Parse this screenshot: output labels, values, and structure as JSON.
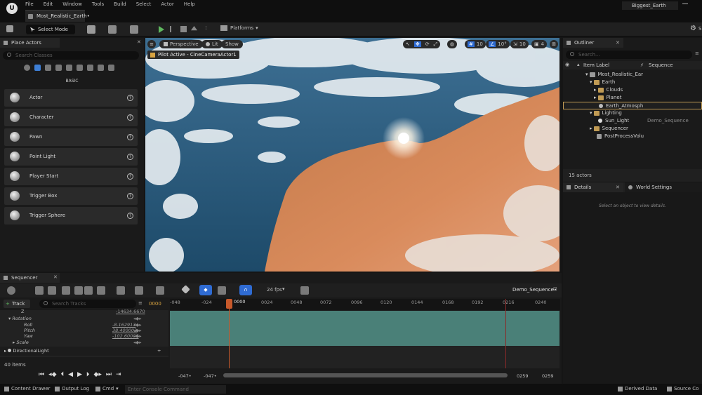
{
  "menu": [
    "File",
    "Edit",
    "Window",
    "Tools",
    "Build",
    "Select",
    "Actor",
    "Help"
  ],
  "level_tab": "Most_Realistic_Earth•",
  "project_name": "Biggest_Earth",
  "toolbar": {
    "select_mode": "Select Mode",
    "platforms": "Platforms",
    "settings_short": "S"
  },
  "place_actors": {
    "title": "Place Actors",
    "search_placeholder": "Search Classes",
    "section": "BASIC",
    "items": [
      "Actor",
      "Character",
      "Pawn",
      "Point Light",
      "Player Start",
      "Trigger Box",
      "Trigger Sphere"
    ]
  },
  "viewport": {
    "perspective": "Perspective",
    "lit": "Lit",
    "show": "Show",
    "pilot_label": "Pilot Active - CineCameraActor1",
    "grid_snap": "10",
    "rot_snap": "10°",
    "scale_snap": "10",
    "cam_speed": "4"
  },
  "outliner": {
    "title": "Outliner",
    "search_placeholder": "Search...",
    "col_label": "Item Label",
    "col_type": "Sequence",
    "rows": [
      {
        "label": "Most_Realistic_Ear",
        "indent": 0
      },
      {
        "label": "Earth",
        "indent": 1
      },
      {
        "label": "Clouds",
        "indent": 2
      },
      {
        "label": "Planet",
        "indent": 2
      },
      {
        "label": "Earth_Atmosph",
        "indent": 2
      },
      {
        "label": "Lighting",
        "indent": 1
      },
      {
        "label": "Sun_Light",
        "indent": 2,
        "seq": "Demo_Sequence"
      },
      {
        "label": "Sequencer",
        "indent": 1
      },
      {
        "label": "PostProcessVolu",
        "indent": 1
      }
    ],
    "count": "15 actors"
  },
  "details": {
    "title": "Details",
    "world_settings": "World Settings",
    "empty_msg": "Select an object to view details."
  },
  "sequencer": {
    "title": "Sequencer",
    "track_btn": "Track",
    "search_placeholder": "Search Tracks",
    "frame": "0000",
    "fps": "24 fps",
    "seq_name": "Demo_Sequence•",
    "timeline_labels": [
      "-048",
      "-024",
      "0000",
      "0024",
      "0048",
      "0072",
      "0096",
      "0120",
      "0144",
      "0168",
      "0192",
      "0216",
      "0240"
    ],
    "playhead": "0000",
    "tracks": [
      {
        "name": "Z",
        "value": "-14634.6670"
      },
      {
        "name": "Rotation",
        "value": ""
      },
      {
        "name": "Roll",
        "value": "-8.162913"
      },
      {
        "name": "Pitch",
        "value": "38.400002"
      },
      {
        "name": "Yaw",
        "value": "-102.60006"
      },
      {
        "name": "Scale",
        "value": ""
      },
      {
        "name": "DirectionalLight",
        "value": ""
      }
    ],
    "items_count": "40 items",
    "range_start": "-047•",
    "range_start2": "-047•",
    "range_end": "0259",
    "range_end2": "0259"
  },
  "statusbar": {
    "content_drawer": "Content Drawer",
    "output_log": "Output Log",
    "cmd": "Cmd",
    "console_placeholder": "Enter Console Command",
    "derived_data": "Derived Data",
    "source_control": "Source Co"
  }
}
